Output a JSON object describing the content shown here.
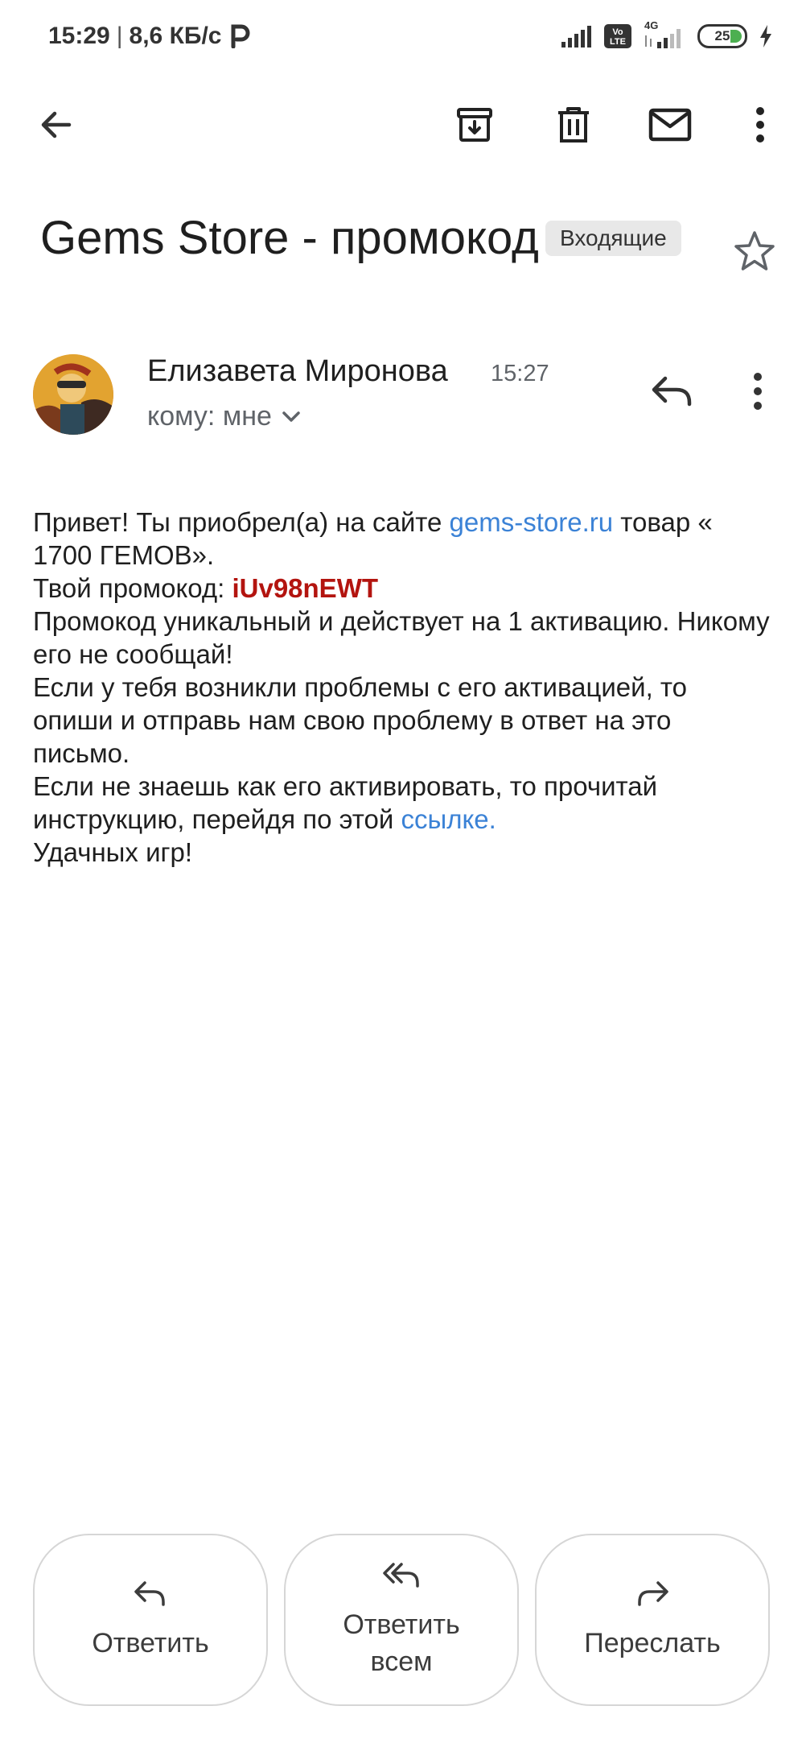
{
  "status_bar": {
    "time": "15:29",
    "speed": "8,6 КБ/с",
    "network_type": "4G",
    "volte": "Vo LTE",
    "battery": "25"
  },
  "toolbar": {
    "back_icon": "arrow-back-icon",
    "archive_icon": "archive-icon",
    "delete_icon": "trash-icon",
    "mark_unread_icon": "mail-icon",
    "more_icon": "more-vert-icon"
  },
  "email": {
    "subject": "Gems Store - промокод",
    "label": "Входящие",
    "sender_name": "Елизавета Миронова",
    "time": "15:27",
    "recipient": "кому: мне",
    "body": {
      "line1_before": "Привет! Ты приобрел(а) на сайте ",
      "link1": "gems-store.ru",
      "line1_after": " товар « 1700 ГЕМОВ».",
      "promo_prefix": "Твой промокод: ",
      "promo_code": "iUv98nEWT",
      "line3": "Промокод уникальный и действует на 1 активацию. Никому его не сообщай!",
      "line4": "Если у тебя возникли проблемы с его активацией, то опиши и отправь нам свою проблему в ответ на это письмо.",
      "line5_before": "Если не знаешь как его активировать, то прочитай инструкцию, перейдя по этой ",
      "link2": "ссылке.",
      "line6": "Удачных игр!"
    }
  },
  "actions": {
    "reply": "Ответить",
    "reply_all": "Ответить всем",
    "forward": "Переслать"
  },
  "colors": {
    "link": "#3b82d6",
    "promo": "#b3140f",
    "chip_bg": "#e8e8e8"
  }
}
